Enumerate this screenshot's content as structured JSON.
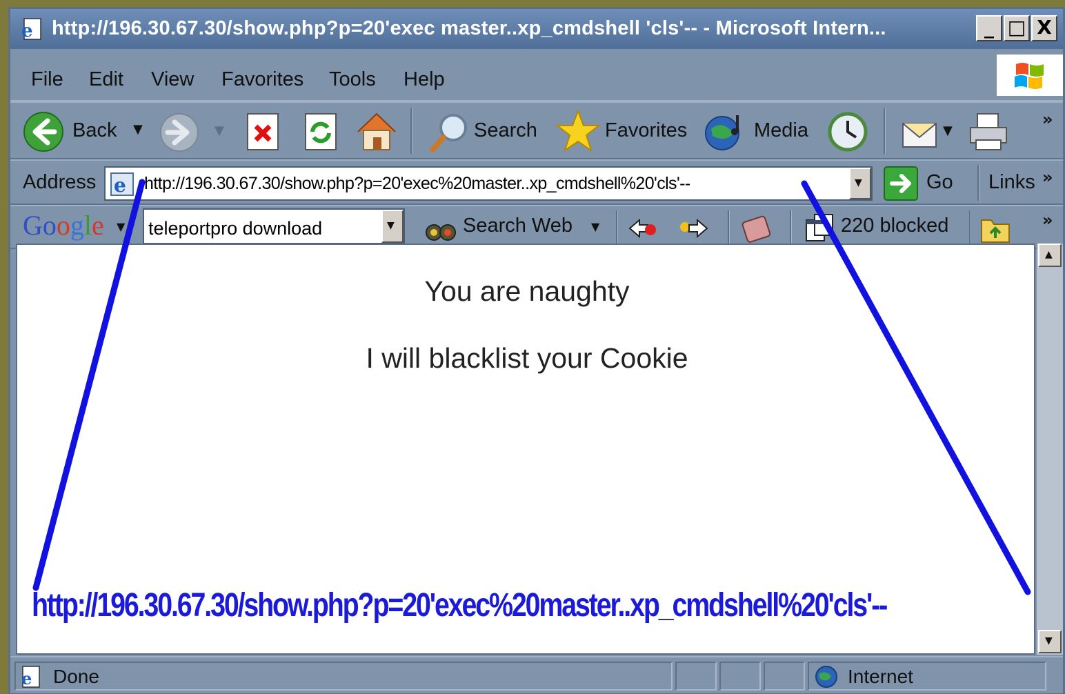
{
  "window": {
    "title": "http://196.30.67.30/show.php?p=20'exec master..xp_cmdshell 'cls'-- - Microsoft Intern...",
    "buttons": {
      "minimize": "_",
      "maximize": "□",
      "close": "X"
    }
  },
  "menu": {
    "items": [
      "File",
      "Edit",
      "View",
      "Favorites",
      "Tools",
      "Help"
    ]
  },
  "toolbar": {
    "back_label": "Back",
    "search_label": "Search",
    "favorites_label": "Favorites",
    "media_label": "Media",
    "more": "»"
  },
  "address_bar": {
    "label": "Address",
    "url": "http://196.30.67.30/show.php?p=20'exec%20master..xp_cmdshell%20'cls'--",
    "go_label": "Go",
    "links_label": "Links",
    "more": "»"
  },
  "google_bar": {
    "brand": "Google",
    "query": "teleportpro download",
    "search_web_label": "Search Web",
    "blocked_label": "220 blocked",
    "more": "»"
  },
  "page": {
    "line1": "You are naughty",
    "line2": "I will blacklist your Cookie"
  },
  "status_bar": {
    "status": "Done",
    "zone": "Internet"
  },
  "annotation": {
    "url": "http://196.30.67.30/show.php?p=20'exec%20master..xp_cmdshell%20'cls'--",
    "color": "#1a1ad8"
  },
  "colors": {
    "chrome": "#7f93aa",
    "title_gradient_top": "#6f8fb8",
    "title_gradient_bottom": "#4f6f99"
  }
}
